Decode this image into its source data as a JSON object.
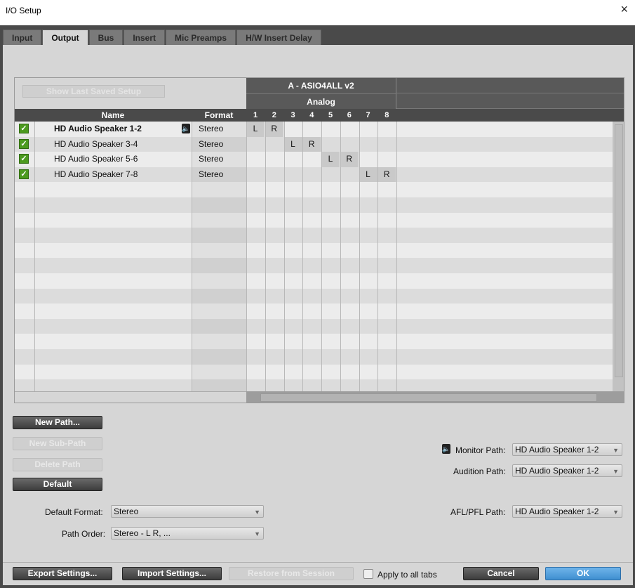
{
  "window": {
    "title": "I/O Setup",
    "close_glyph": "×"
  },
  "tabs": [
    {
      "label": "Input",
      "active": false
    },
    {
      "label": "Output",
      "active": true
    },
    {
      "label": "Bus",
      "active": false
    },
    {
      "label": "Insert",
      "active": false
    },
    {
      "label": "Mic Preamps",
      "active": false
    },
    {
      "label": "H/W Insert Delay",
      "active": false
    }
  ],
  "matrix": {
    "show_last_saved": "Show Last Saved Setup",
    "device": "A - ASIO4ALL v2",
    "device_group": "Analog",
    "col_name": "Name",
    "col_format": "Format",
    "channels": [
      "1",
      "2",
      "3",
      "4",
      "5",
      "6",
      "7",
      "8"
    ],
    "rows": [
      {
        "checked": true,
        "name": "HD Audio Speaker 1-2",
        "bold": true,
        "monitor": true,
        "format": "Stereo",
        "cells": [
          "L",
          "R",
          "",
          "",
          "",
          "",
          "",
          ""
        ]
      },
      {
        "checked": true,
        "name": "HD Audio Speaker 3-4",
        "bold": false,
        "monitor": false,
        "format": "Stereo",
        "cells": [
          "",
          "",
          "L",
          "R",
          "",
          "",
          "",
          ""
        ]
      },
      {
        "checked": true,
        "name": "HD Audio Speaker 5-6",
        "bold": false,
        "monitor": false,
        "format": "Stereo",
        "cells": [
          "",
          "",
          "",
          "",
          "L",
          "R",
          "",
          ""
        ]
      },
      {
        "checked": true,
        "name": "HD Audio Speaker 7-8",
        "bold": false,
        "monitor": false,
        "format": "Stereo",
        "cells": [
          "",
          "",
          "",
          "",
          "",
          "",
          "L",
          "R"
        ]
      }
    ],
    "check_glyph": "✓",
    "speaker_glyph": "🔈"
  },
  "left_buttons": {
    "new_path": "New Path...",
    "new_sub_path": "New Sub-Path",
    "delete_path": "Delete Path",
    "default": "Default"
  },
  "defaults": {
    "format_label": "Default Format:",
    "format_value": "Stereo",
    "order_label": "Path Order:",
    "order_value": "Stereo - L R, ..."
  },
  "paths": {
    "monitor_label": "Monitor Path:",
    "monitor_value": "HD Audio Speaker 1-2",
    "audition_label": "Audition Path:",
    "audition_value": "HD Audio Speaker 1-2",
    "afl_label": "AFL/PFL Path:",
    "afl_value": "HD Audio Speaker 1-2"
  },
  "bottom": {
    "export": "Export Settings...",
    "import": "Import Settings...",
    "restore": "Restore from Session",
    "apply_all": "Apply to all tabs",
    "cancel": "Cancel",
    "ok": "OK"
  },
  "colors": {
    "frame": "#4a4a4a",
    "panel": "#d6d6d6",
    "header": "#595959",
    "checkbox_green": "#4c9a1f",
    "ok_blue": "#3f8fd0"
  }
}
